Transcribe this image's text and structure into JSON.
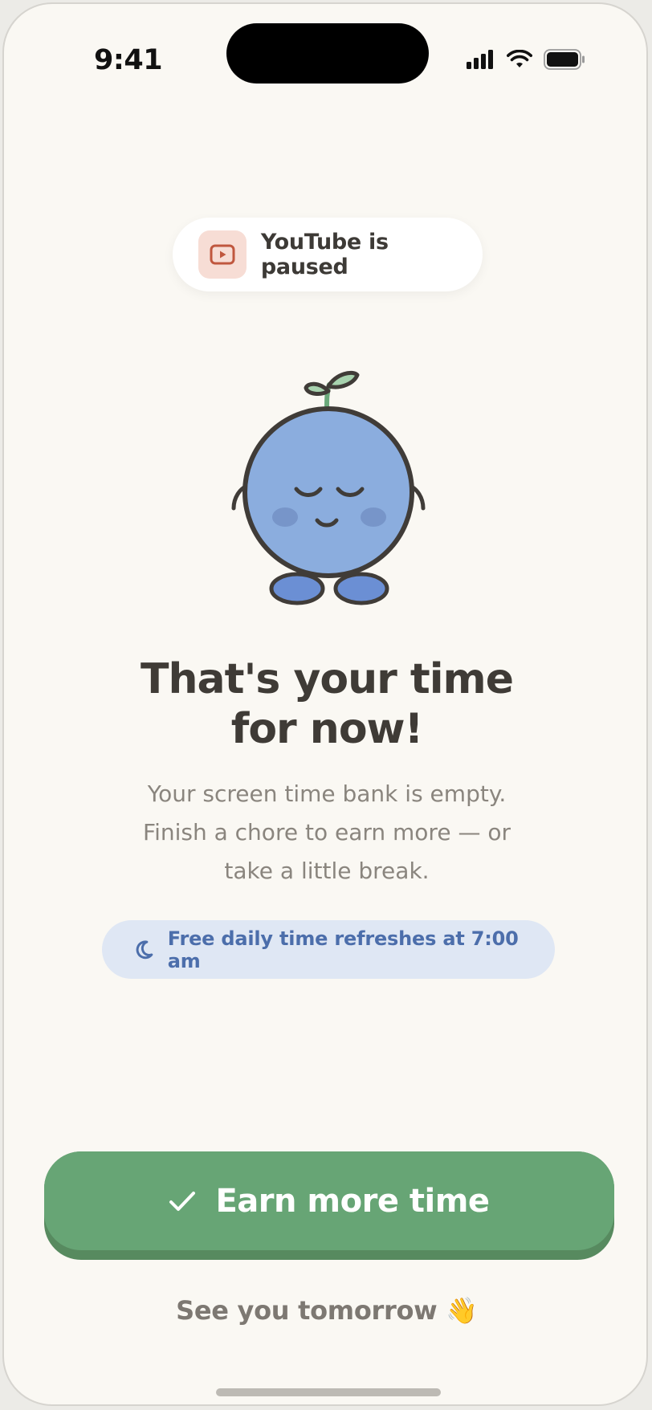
{
  "status_bar": {
    "time": "9:41",
    "icons": [
      "signal-icon",
      "wifi-icon",
      "battery-icon"
    ]
  },
  "badge": {
    "icon": "play-video-icon",
    "label": "YouTube is paused"
  },
  "headline": {
    "line1": "That's your time",
    "line2": "for now!"
  },
  "message": {
    "line1": "Your screen time bank is empty.",
    "line2": "Finish a chore to earn more — or",
    "line3": "take a little break."
  },
  "refresh_notice": {
    "icon": "moon-icon",
    "label": "Free daily time refreshes at 7:00 am"
  },
  "primary_button": {
    "icon": "checkmark-icon",
    "label": "Earn more time"
  },
  "secondary_link": {
    "label": "See you tomorrow 👋"
  },
  "colors": {
    "background": "#faf8f3",
    "primary_green": "#67a575",
    "text_dark": "#3f3b36",
    "text_muted": "#8a857e",
    "accent_blue": "#4c6eab",
    "mascot_body": "#8badde",
    "badge_red": "#c0573e"
  }
}
